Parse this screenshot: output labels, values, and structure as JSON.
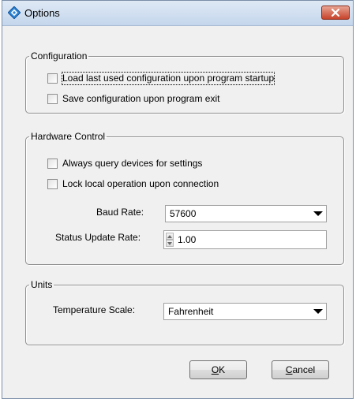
{
  "window": {
    "title": "Options",
    "app_icon": "options-app-icon",
    "close_icon": "close-icon"
  },
  "configuration": {
    "title": "Configuration",
    "checkboxes": [
      {
        "label": "Load last used configuration upon program startup",
        "checked": false
      },
      {
        "label": "Save configuration upon program exit",
        "checked": false
      }
    ]
  },
  "hardware": {
    "title": "Hardware Control",
    "checkboxes": [
      {
        "label": "Always query devices for settings",
        "checked": false
      },
      {
        "label": "Lock local operation upon connection",
        "checked": false
      }
    ],
    "baud_rate": {
      "label": "Baud Rate:",
      "value": "57600"
    },
    "status_update_rate": {
      "label": "Status Update Rate:",
      "value": "1.00"
    }
  },
  "units": {
    "title": "Units",
    "temperature_scale": {
      "label": "Temperature Scale:",
      "value": "Fahrenheit"
    }
  },
  "buttons": {
    "ok": {
      "mnemonic": "O",
      "rest": "K"
    },
    "cancel": {
      "mnemonic": "C",
      "rest": "ancel"
    }
  },
  "colors": {
    "title_bar": "#c4d6ec",
    "close_button": "#c7432a",
    "dialog_background": "#f0f0f0"
  }
}
